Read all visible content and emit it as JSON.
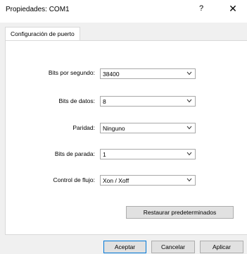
{
  "window": {
    "title": "Propiedades: COM1",
    "help_glyph": "?",
    "close_glyph": "✕"
  },
  "tabs": [
    {
      "label": "Configuración de puerto",
      "selected": true
    }
  ],
  "fields": [
    {
      "label": "Bits por segundo:",
      "value": "38400"
    },
    {
      "label": "Bits de datos:",
      "value": "8"
    },
    {
      "label": "Paridad:",
      "value": "Ninguno"
    },
    {
      "label": "Bits de parada:",
      "value": "1"
    },
    {
      "label": "Control de flujo:",
      "value": "Xon / Xoff"
    }
  ],
  "buttons": {
    "restore_label": "Restaurar predeterminados",
    "ok_label": "Aceptar",
    "cancel_label": "Cancelar",
    "apply_label": "Aplicar"
  },
  "colors": {
    "default_button_border": "#0078d7",
    "dialog_background": "#f0f0f0"
  }
}
